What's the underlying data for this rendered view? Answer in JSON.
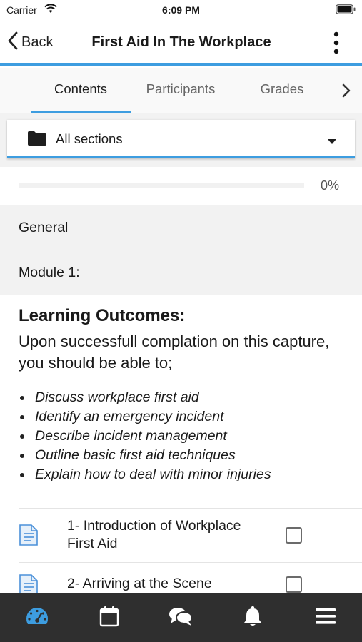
{
  "status_bar": {
    "carrier": "Carrier",
    "time": "6:09 PM"
  },
  "nav": {
    "back_label": "Back",
    "title": "First Aid In The Workplace"
  },
  "tabs": [
    {
      "label": "Contents",
      "active": true
    },
    {
      "label": "Participants",
      "active": false
    },
    {
      "label": "Grades",
      "active": false
    }
  ],
  "section_selector": {
    "selected": "All sections"
  },
  "progress": {
    "value": 0,
    "text": "0%"
  },
  "sections": {
    "general": "General",
    "module": "Module 1:"
  },
  "learning_outcomes": {
    "title": "Learning Outcomes:",
    "intro": "Upon successfull complation on this capture, you should be able to;",
    "items": [
      "Discuss workplace first aid",
      "Identify an emergency incident",
      "Describe incident management",
      "Outline basic first aid techniques",
      "Explain how to deal with minor injuries"
    ]
  },
  "activities": [
    {
      "line1": "1- Introduction of Workplace",
      "line2": "First Aid",
      "completed": false
    },
    {
      "line1": "2- Arriving at the Scene",
      "line2": "",
      "completed": false
    }
  ],
  "bottom_nav": [
    {
      "icon": "dashboard-icon",
      "active": true
    },
    {
      "icon": "calendar-icon",
      "active": false
    },
    {
      "icon": "messages-icon",
      "active": false
    },
    {
      "icon": "notifications-icon",
      "active": false
    },
    {
      "icon": "menu-icon",
      "active": false
    }
  ],
  "colors": {
    "accent": "#3d9de0",
    "bottom_bar": "#2f2f2f",
    "section_bg": "#f2f2f2"
  }
}
